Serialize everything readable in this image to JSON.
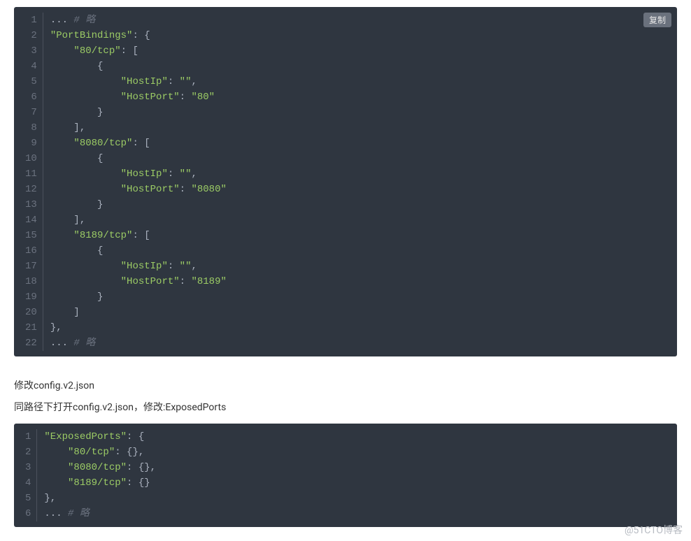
{
  "copyLabel": "复制",
  "paragraph1": "修改config.v2.json",
  "paragraph2": "同路径下打开config.v2.json，修改:ExposedPorts",
  "watermark": "@51CTO博客",
  "block1": {
    "leading": "...",
    "comment": " # 略",
    "k_portbindings": "\"PortBindings\"",
    "v_openbrace": ": {",
    "k_80tcp": "\"80/tcp\"",
    "k_8080tcp": "\"8080/tcp\"",
    "k_8189tcp": "\"8189/tcp\"",
    "arr_open": ": [",
    "l_brace_open": "{",
    "l_brace_close": "}",
    "arr_close_comma": "],",
    "arr_close": "]",
    "close_brace_comma": "},",
    "hostip_label": "\"HostIp\"",
    "hostip_empty": "\"\"",
    "hostport_label": "\"HostPort\"",
    "port80": "\"80\"",
    "port8080": "\"8080\"",
    "port8189": "\"8189\"",
    "colon_space": ": ",
    "comma": ","
  },
  "block2": {
    "k_exposedports": "\"ExposedPorts\"",
    "v_openbrace": ": {",
    "k_80tcp": "\"80/tcp\"",
    "k_8080tcp": "\"8080/tcp\"",
    "k_8189tcp": "\"8189/tcp\"",
    "emptyobj_comma": ": {},",
    "emptyobj": ": {}",
    "close_brace_comma": "},",
    "leading": "...",
    "comment": " # 略"
  }
}
